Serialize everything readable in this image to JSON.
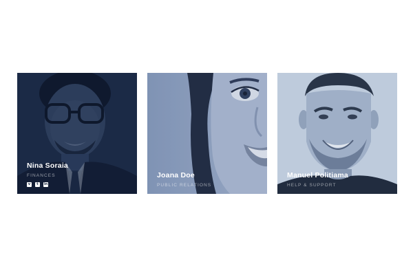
{
  "team": [
    {
      "name": "Nina Soraia",
      "role": "Finances",
      "social": [
        {
          "icon": "vk-icon",
          "glyph": "v"
        },
        {
          "icon": "twitter-icon",
          "glyph": "t"
        },
        {
          "icon": "linkedin-icon",
          "glyph": "in"
        }
      ]
    },
    {
      "name": "Joana Doe",
      "role": "Public Relations"
    },
    {
      "name": "Manuel Politiama",
      "role": "Help & Support"
    }
  ],
  "colors": {
    "overlay_dark": "#13203a",
    "overlay_light": "#6f86aa",
    "text": "#ffffff"
  }
}
